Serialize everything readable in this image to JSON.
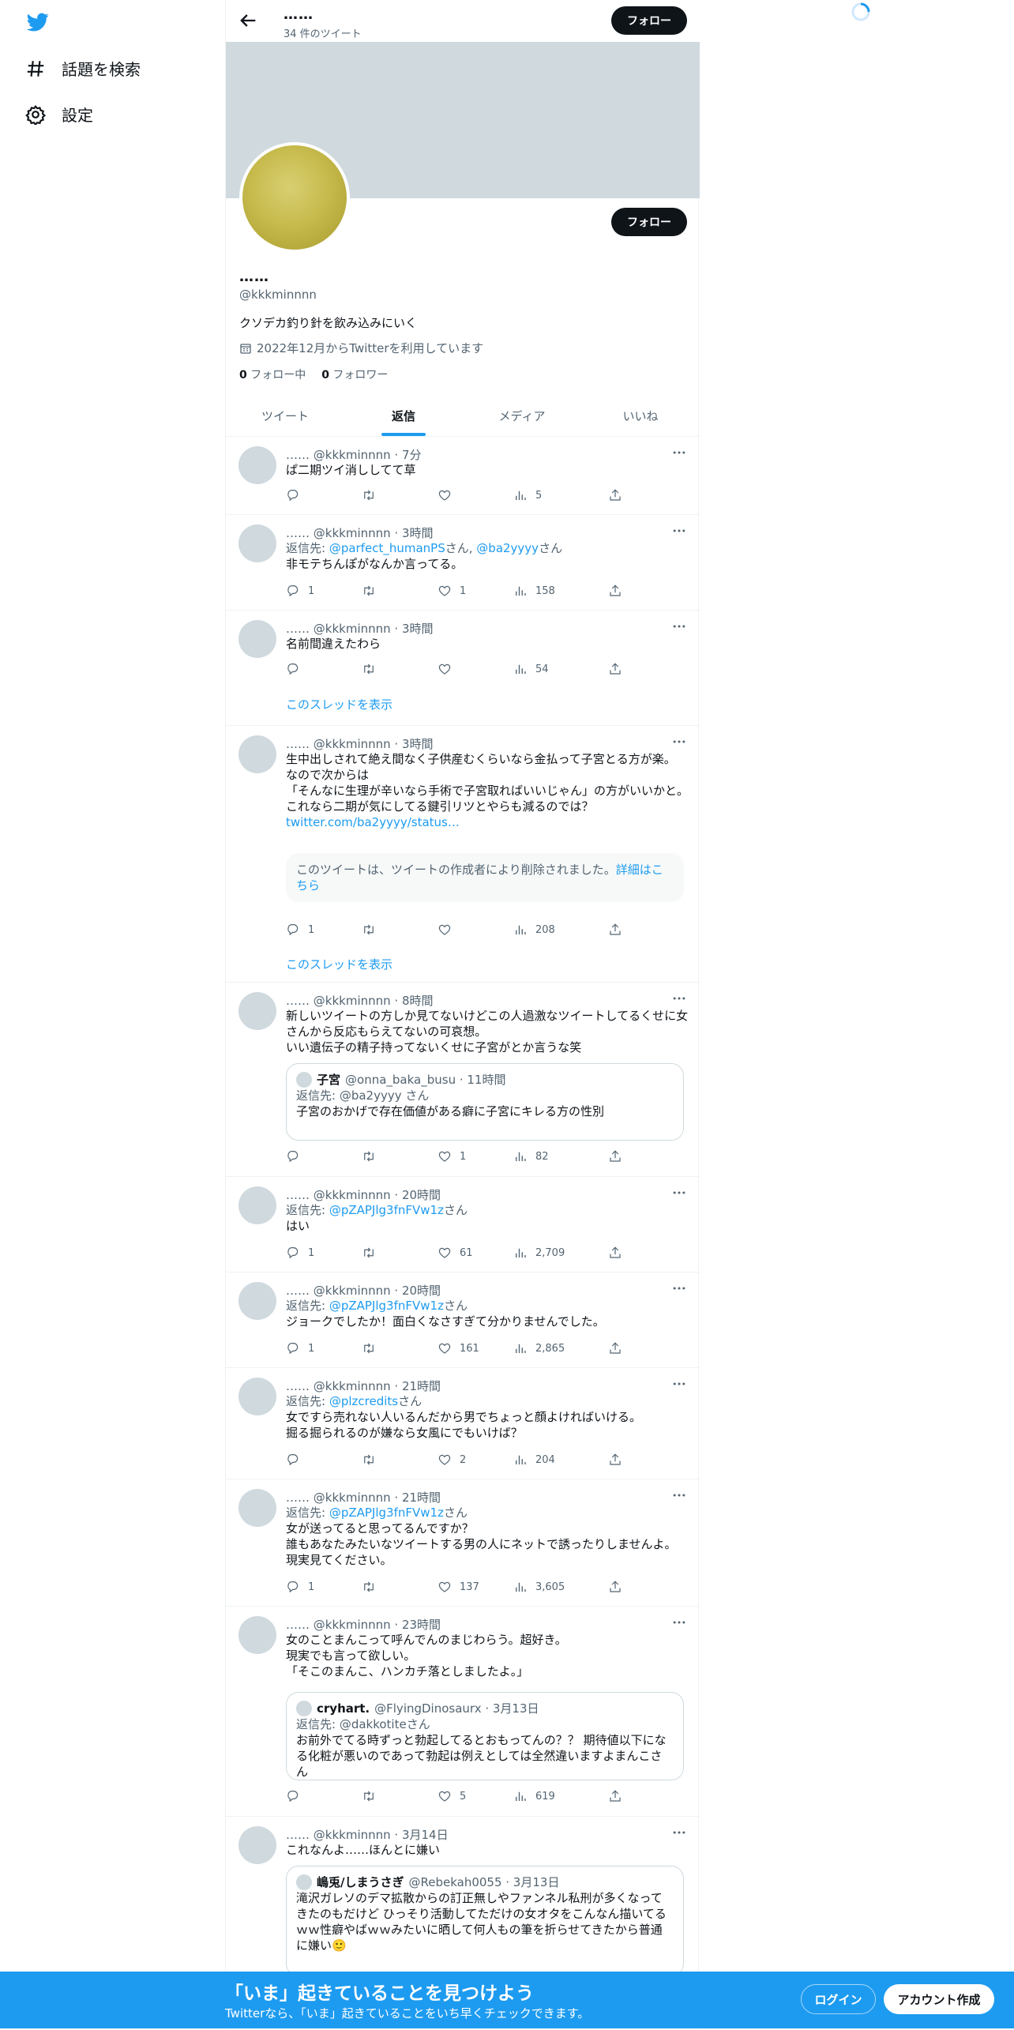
{
  "sidebar": {
    "logo": "twitter-bird-icon",
    "items": [
      {
        "label": "話題を検索",
        "icon": "hashtag-icon"
      },
      {
        "label": "設定",
        "icon": "gear-icon"
      }
    ]
  },
  "header": {
    "name": "……",
    "tweet_count": "34 件のツイート",
    "follow_label": "フォロー"
  },
  "profile": {
    "name": "……",
    "handle": "@kkkminnnn",
    "bio": "クソデカ釣り針を飲み込みにいく",
    "joined": "2022年12月からTwitterを利用しています",
    "following_count": "0",
    "following_label": "フォロー中",
    "followers_count": "0",
    "followers_label": "フォロワー",
    "follow_label": "フォロー"
  },
  "tabs": [
    "ツイート",
    "返信",
    "メディア",
    "いいね"
  ],
  "active_tab": "返信",
  "thread_link": "このスレッドを表示",
  "tweets": [
    {
      "header": "…… @kkkminnnn · 7分",
      "lines": [
        "ぱ二期ツイ消ししてて草"
      ],
      "replies": "",
      "retweets": "",
      "likes": "",
      "views": "5"
    },
    {
      "header": "…… @kkkminnnn · 3時間",
      "reply_prefix": "返信先: ",
      "reply_users": "@parfect_humanPS",
      "reply_mid": "さん, ",
      "reply_users2": "@ba2yyyy",
      "reply_suffix": "さん",
      "lines": [
        "非モテちんぽがなんか言ってる。"
      ],
      "replies": "1",
      "retweets": "",
      "likes": "1",
      "views": "158"
    },
    {
      "header": "…… @kkkminnnn · 3時間",
      "lines": [
        "名前間違えたわら"
      ],
      "replies": "",
      "retweets": "",
      "likes": "",
      "views": "54"
    },
    {
      "header": "…… @kkkminnnn · 3時間",
      "lines": [
        "生中出しされて絶え間なく子供産むくらいなら金払って子宮とる方が楽。",
        "なので次からは",
        "「そんなに生理が辛いなら手術で子宮取ればいいじゃん」の方がいいかと。",
        "これなら二期が気にしてる鍵引リツとやらも減るのでは？"
      ],
      "link": "twitter.com/ba2yyyy/status…",
      "quote_deleted": "このツイートは、ツイートの作成者により削除されました。",
      "quote_more": "詳細はこちら",
      "replies": "1",
      "retweets": "",
      "likes": "",
      "views": "208"
    },
    {
      "header": "…… @kkkminnnn · 8時間",
      "lines": [
        "新しいツイートの方しか見てないけどこの人過激なツイートしてるくせに女さんから反応もらえてないの可哀想。",
        "いい遺伝子の精子持ってないくせに子宮がとか言うな笑"
      ],
      "quote": {
        "name": "子宮",
        "meta": "@onna_baka_busu · 11時間",
        "reply": "返信先: @ba2yyyy さん",
        "text": "子宮のおかげで存在価値がある癖に子宮にキレる方の性別"
      },
      "replies": "",
      "retweets": "",
      "likes": "1",
      "views": "82"
    },
    {
      "header": "…… @kkkminnnn · 20時間",
      "reply_prefix": "返信先: ",
      "reply_users": "@pZAPJlg3fnFVw1z",
      "reply_suffix": "さん",
      "lines": [
        "はい"
      ],
      "replies": "1",
      "retweets": "",
      "likes": "61",
      "views": "2,709"
    },
    {
      "header": "…… @kkkminnnn · 20時間",
      "reply_prefix": "返信先: ",
      "reply_users": "@pZAPJlg3fnFVw1z",
      "reply_suffix": "さん",
      "lines": [
        "ジョークでしたか！面白くなさすぎて分かりませんでした。"
      ],
      "replies": "1",
      "retweets": "",
      "likes": "161",
      "views": "2,865"
    },
    {
      "header": "…… @kkkminnnn · 21時間",
      "reply_prefix": "返信先: ",
      "reply_users": "@plzcredits",
      "reply_suffix": "さん",
      "lines": [
        "女ですら売れない人いるんだから男でちょっと顔よければいける。",
        "掘る掘られるのが嫌なら女風にでもいけば？"
      ],
      "replies": "",
      "retweets": "",
      "likes": "2",
      "views": "204"
    },
    {
      "header": "…… @kkkminnnn · 21時間",
      "reply_prefix": "返信先: ",
      "reply_users": "@pZAPJlg3fnFVw1z",
      "reply_suffix": "さん",
      "lines": [
        "女が送ってると思ってるんですか？",
        "誰もあなたみたいなツイートする男の人にネットで誘ったりしませんよ。",
        "現実見てください。"
      ],
      "replies": "1",
      "retweets": "",
      "likes": "137",
      "views": "3,605"
    },
    {
      "header": "…… @kkkminnnn · 23時間",
      "lines": [
        "女のことまんこって呼んでんのまじわらう。超好き。",
        "現実でも言って欲しい。",
        "「そこのまんこ、ハンカチ落としましたよ。」"
      ],
      "quote": {
        "name": "cryhart.",
        "meta": "@FlyingDinosaurx · 3月13日",
        "reply": "返信先: @dakkotiteさん",
        "text": "お前外でてる時ずっと勃起してるとおもってんの？？ 期待値以下になる化粧が悪いのであって勃起は例えとしては全然違いますよまんこさん"
      },
      "replies": "",
      "retweets": "",
      "likes": "5",
      "views": "619"
    },
    {
      "header": "…… @kkkminnnn · 3月14日",
      "lines": [
        "これなんよ……ほんとに嫌い"
      ],
      "quote": {
        "name": "嶋兎/しまうさぎ",
        "meta": "@Rebekah0055 · 3月13日",
        "reply": "",
        "text": "滝沢ガレソのデマ拡散からの訂正無しやファンネル私刑が多くなってきたのもだけど ひっそり活動してただけの女オタをこんなん描いてるｗｗ性癖やばｗｗみたいに晒して何人もの筆を折らせてきたから普通に嫌い🙂"
      },
      "replies": "",
      "retweets": "",
      "likes": "",
      "views": ""
    }
  ],
  "bottom_bar": {
    "title": "「いま」起きていることを見つけよう",
    "subtitle": "Twitterなら、「いま」起きていることをいち早くチェックできます。",
    "login_label": "ログイン",
    "signup_label": "アカウント作成"
  },
  "colors": {
    "accent": "#1d9bf0",
    "text": "#0f1419",
    "secondary": "#536471",
    "banner": "#cfd9de"
  }
}
